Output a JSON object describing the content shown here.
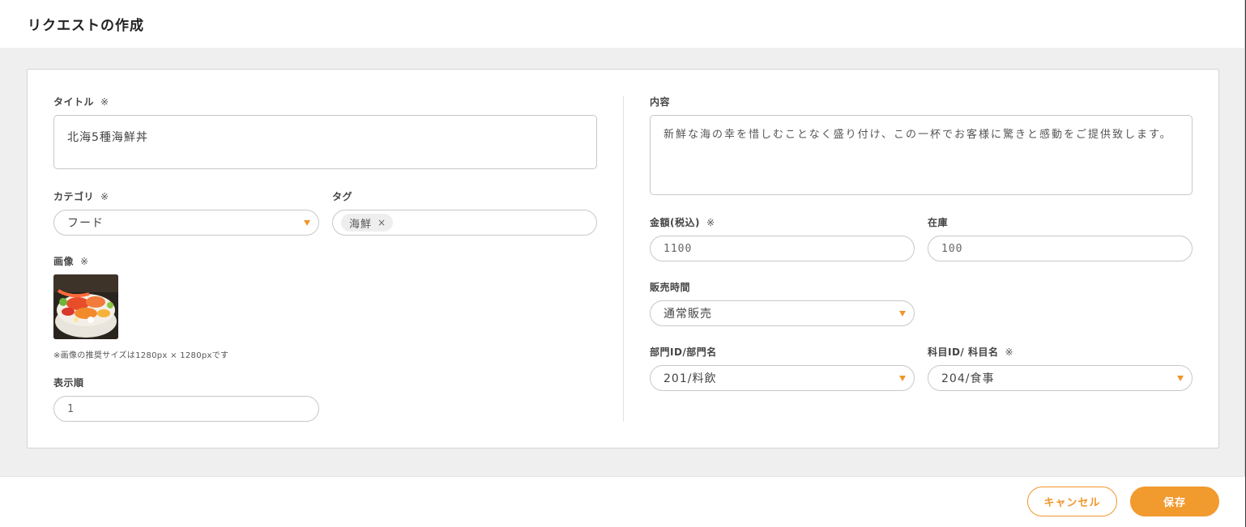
{
  "modal": {
    "title": "リクエストの作成"
  },
  "form": {
    "required_mark": "※",
    "title": {
      "label": "タイトル",
      "value": "北海5種海鮮丼"
    },
    "category": {
      "label": "カテゴリ",
      "value": "フード"
    },
    "tag": {
      "label": "タグ",
      "chips": [
        "海鮮"
      ],
      "remove_glyph": "×"
    },
    "image": {
      "label": "画像",
      "note": "※画像の推奨サイズは1280px × 1280pxです"
    },
    "display_order": {
      "label": "表示順",
      "value": "1"
    },
    "content": {
      "label": "内容",
      "value": "新鮮な海の幸を惜しむことなく盛り付け、この一杯でお客様に驚きと感動をご提供致します。"
    },
    "price": {
      "label": "金額(税込)",
      "value": "1100"
    },
    "stock": {
      "label": "在庫",
      "value": "100"
    },
    "sales_time": {
      "label": "販売時間",
      "value": "通常販売"
    },
    "department": {
      "label": "部門ID/部門名",
      "value": "201/料飲"
    },
    "subject": {
      "label": "科目ID/ 科目名",
      "value": "204/食事"
    }
  },
  "footer": {
    "cancel_label": "キャンセル",
    "save_label": "保存"
  },
  "colors": {
    "accent": "#f19a2e",
    "background": "#efefef"
  }
}
